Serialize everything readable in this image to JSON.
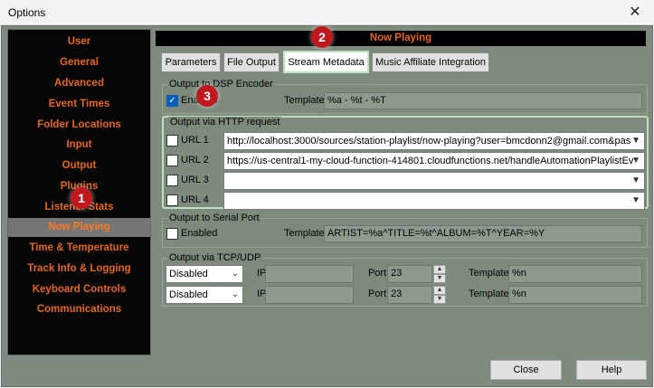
{
  "window": {
    "title": "Options",
    "close": "✕"
  },
  "sidebar": {
    "items": [
      {
        "label": "User"
      },
      {
        "label": "General"
      },
      {
        "label": "Advanced"
      },
      {
        "label": "Event Times"
      },
      {
        "label": "Folder Locations"
      },
      {
        "label": "Input"
      },
      {
        "label": "Output"
      },
      {
        "label": "Plugins"
      },
      {
        "label": "Listener Stats"
      },
      {
        "label": "Now Playing"
      },
      {
        "label": "Time & Temperature"
      },
      {
        "label": "Track Info & Logging"
      },
      {
        "label": "Keyboard Controls"
      },
      {
        "label": "Communications"
      }
    ],
    "active_index": 9
  },
  "header": {
    "title": "Now Playing"
  },
  "tabs": [
    {
      "label": "Parameters"
    },
    {
      "label": "File Output"
    },
    {
      "label": "Stream Metadata"
    },
    {
      "label": "Music Affiliate Integration"
    }
  ],
  "dsp": {
    "group_label": "Output to DSP Encoder",
    "enabled_label": "Enabled",
    "enabled": true,
    "template_label": "Template",
    "template_value": "%a - %t - %T"
  },
  "http": {
    "group_label": "Output via HTTP request",
    "urls": [
      {
        "label": "URL 1",
        "value": "http://localhost:3000/sources/station-playlist/now-playing?user=bmcdonn2@gmail.com&pas"
      },
      {
        "label": "URL 2",
        "value": "https://us-central1-my-cloud-function-414801.cloudfunctions.net/handleAutomationPlaylistEv"
      },
      {
        "label": "URL 3",
        "value": ""
      },
      {
        "label": "URL 4",
        "value": ""
      }
    ]
  },
  "serial": {
    "group_label": "Output to Serial Port",
    "enabled_label": "Enabled",
    "template_label": "Template",
    "template_value": "ARTIST=%a^TITLE=%t^ALBUM=%T^YEAR=%Y"
  },
  "tcp": {
    "group_label": "Output via TCP/UDP",
    "rows": [
      {
        "mode": "Disabled",
        "ip_label": "IP",
        "ip": "",
        "port_label": "Port",
        "port": "23",
        "template_label": "Template",
        "template": "%n"
      },
      {
        "mode": "Disabled",
        "ip_label": "IP",
        "ip": "",
        "port_label": "Port",
        "port": "23",
        "template_label": "Template",
        "template": "%n"
      }
    ]
  },
  "buttons": {
    "close": "Close",
    "help": "Help"
  },
  "annotations": [
    "1",
    "2",
    "3"
  ]
}
